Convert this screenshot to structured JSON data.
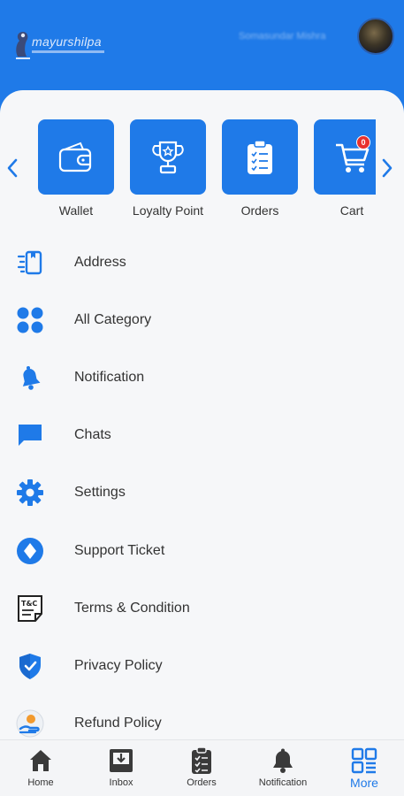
{
  "header": {
    "logo_text": "mayurshilpa",
    "user_name": "Somasundar Mishra"
  },
  "quick_actions": [
    {
      "label": "Wallet",
      "icon": "wallet-icon"
    },
    {
      "label": "Loyalty Point",
      "icon": "trophy-icon"
    },
    {
      "label": "Orders",
      "icon": "clipboard-icon"
    },
    {
      "label": "Cart",
      "icon": "cart-icon",
      "badge": "0"
    }
  ],
  "menu": [
    {
      "label": "Address",
      "icon": "address-icon"
    },
    {
      "label": "All Category",
      "icon": "category-icon"
    },
    {
      "label": "Notification",
      "icon": "bell-icon"
    },
    {
      "label": "Chats",
      "icon": "chat-icon"
    },
    {
      "label": "Settings",
      "icon": "gear-icon"
    },
    {
      "label": "Support Ticket",
      "icon": "support-ticket-icon"
    },
    {
      "label": "Terms & Condition",
      "icon": "terms-icon"
    },
    {
      "label": "Privacy Policy",
      "icon": "shield-icon"
    },
    {
      "label": "Refund Policy",
      "icon": "refund-icon"
    }
  ],
  "tc_icon_text": "T&C",
  "bottom_nav": [
    {
      "label": "Home",
      "icon": "home-icon"
    },
    {
      "label": "Inbox",
      "icon": "inbox-icon"
    },
    {
      "label": "Orders",
      "icon": "orders-icon"
    },
    {
      "label": "Notification",
      "icon": "bell-icon"
    },
    {
      "label": "More",
      "icon": "more-grid-icon",
      "active": true
    }
  ],
  "colors": {
    "brand": "#1f7ae8",
    "badge": "#e8312d",
    "background": "#f6f7f9"
  }
}
